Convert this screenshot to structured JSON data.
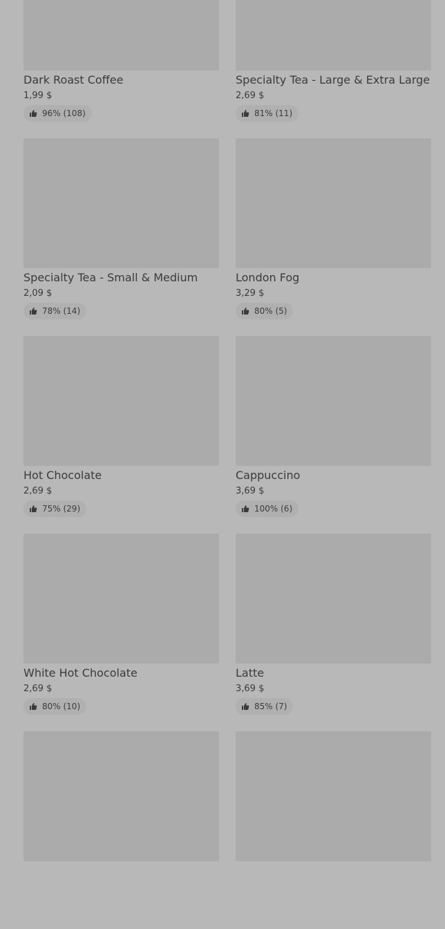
{
  "products": [
    {
      "name": "Dark Roast Coffee",
      "price": "1,99 $",
      "rating": "96% (108)"
    },
    {
      "name": "Specialty Tea - Large & Extra Large",
      "price": "2,69 $",
      "rating": "81% (11)"
    },
    {
      "name": "Specialty Tea - Small & Medium",
      "price": "2,09 $",
      "rating": "78% (14)"
    },
    {
      "name": "London Fog",
      "price": "3,29 $",
      "rating": "80% (5)"
    },
    {
      "name": "Hot Chocolate",
      "price": "2,69 $",
      "rating": "75% (29)"
    },
    {
      "name": "Cappuccino",
      "price": "3,69 $",
      "rating": "100% (6)"
    },
    {
      "name": "White Hot Chocolate",
      "price": "2,69 $",
      "rating": "80% (10)"
    },
    {
      "name": "Latte",
      "price": "3,69 $",
      "rating": "85% (7)"
    },
    {
      "name": "",
      "price": "",
      "rating": ""
    },
    {
      "name": "",
      "price": "",
      "rating": ""
    }
  ],
  "icons": {
    "rating": "thumbs-up-icon"
  }
}
